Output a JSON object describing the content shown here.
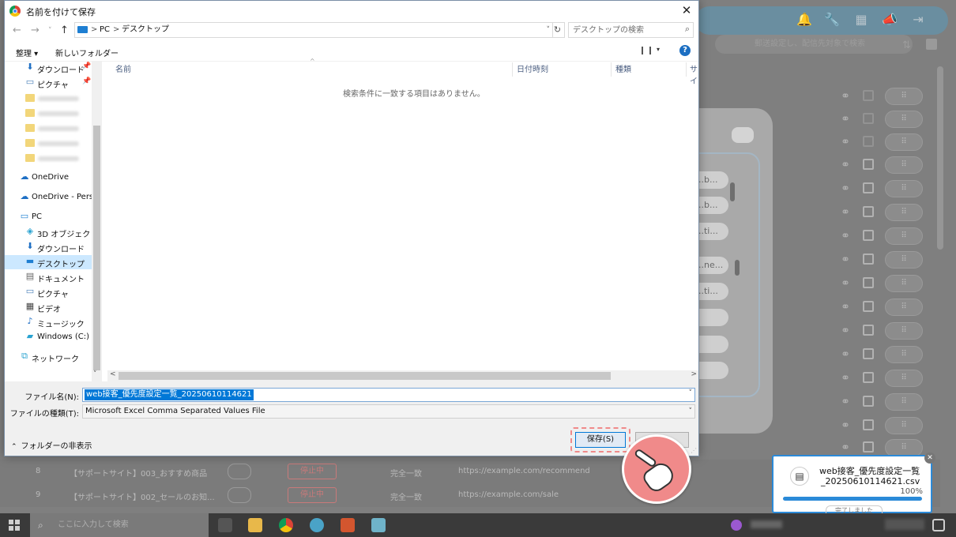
{
  "dialog": {
    "title": "名前を付けて保存",
    "close_label": "✕",
    "address": {
      "crumbs": [
        "PC",
        "デスクトップ"
      ],
      "separator": ">"
    },
    "search_placeholder": "デスクトップの検索",
    "toolbar": {
      "organize": "整理 ▾",
      "new_folder": "新しいフォルダー",
      "help": "?"
    },
    "nav": {
      "quick": [
        {
          "label": "ダウンロード",
          "icon": "download-icon"
        },
        {
          "label": "ピクチャ",
          "icon": "pictures-icon"
        }
      ],
      "onedrive": "OneDrive",
      "onedrive_personal": "OneDrive - Personal",
      "pc": "PC",
      "pc_items": [
        {
          "label": "3D オブジェクト",
          "icon": "3d-objects-icon"
        },
        {
          "label": "ダウンロード",
          "icon": "download-icon"
        },
        {
          "label": "デスクトップ",
          "icon": "desktop-icon",
          "selected": true
        },
        {
          "label": "ドキュメント",
          "icon": "documents-icon"
        },
        {
          "label": "ピクチャ",
          "icon": "pictures-icon"
        },
        {
          "label": "ビデオ",
          "icon": "videos-icon"
        },
        {
          "label": "ミュージック",
          "icon": "music-icon"
        },
        {
          "label": "Windows (C:)",
          "icon": "drive-icon"
        }
      ],
      "network": "ネットワーク"
    },
    "columns": {
      "name": "名前",
      "date": "日付時刻",
      "type": "種類",
      "size": "サイ"
    },
    "empty_message": "検索条件に一致する項目はありません。",
    "form": {
      "filename_label": "ファイル名(N):",
      "filename_value": "web接客_優先度設定一覧_20250610114621",
      "filetype_label": "ファイルの種類(T):",
      "filetype_value": "Microsoft Excel Comma Separated Values File",
      "hide_folders": "フォルダーの非表示",
      "save": "保存(S)"
    }
  },
  "background": {
    "search_placeholder": "郵送設定し、配信先対象で検索",
    "rows": [
      {
        "num": "8",
        "name": "【サポートサイト】003_おすすめ商品",
        "status": "停止中",
        "match": "完全一致",
        "url": "https://example.com/recommend"
      },
      {
        "num": "9",
        "name": "【サポートサイト】002_セールのお知...",
        "status": "停止中",
        "match": "完全一致",
        "url": "https://example.com/sale"
      }
    ],
    "panel_pills": [
      "..b...",
      "..b...",
      "..ti...",
      "..ne...",
      "..ti..."
    ]
  },
  "download": {
    "filename_line1": "web接客_優先度設定一覧",
    "filename_line2": "_20250610114621.csv",
    "percent_text": "100%",
    "progress": 1.0,
    "done_label": "完了しました"
  },
  "taskbar": {
    "search_placeholder": "ここに入力して検索"
  },
  "colors": {
    "accent": "#0078d7",
    "highlight": "#f08a8a",
    "progress": "#2b8ad8"
  }
}
